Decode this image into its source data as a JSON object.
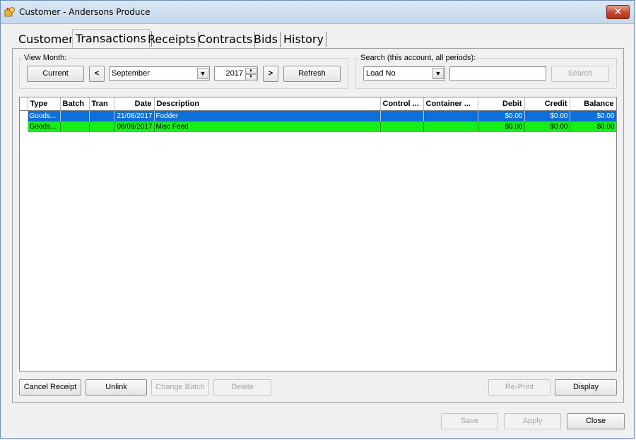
{
  "window": {
    "title": "Customer - Andersons Produce",
    "close_glyph": "✕"
  },
  "tabs": [
    {
      "label": "Customer"
    },
    {
      "label": "Transactions"
    },
    {
      "label": "Receipts"
    },
    {
      "label": "Contracts"
    },
    {
      "label": "Bids"
    },
    {
      "label": "History"
    }
  ],
  "active_tab": "Transactions",
  "view_month": {
    "label": "View Month:",
    "current_button": "Current",
    "prev_button": "<",
    "month": "September",
    "year": "2017",
    "next_button": ">",
    "refresh_button": "Refresh"
  },
  "search": {
    "label": "Search (this account, all periods):",
    "field": "Load No",
    "value": "",
    "search_button": "Search"
  },
  "grid": {
    "columns": [
      "",
      "Type",
      "Batch",
      "Tran",
      "Date",
      "Description",
      "Control ...",
      "Container ...",
      "Debit",
      "Credit",
      "Balance"
    ],
    "rows": [
      {
        "type": "Goods...",
        "batch": "",
        "tran": "",
        "date": "21/08/2017",
        "description": "Fodder",
        "control": "",
        "container": "",
        "debit": "$0.00",
        "credit": "$0.00",
        "balance": "$0.00",
        "state": "selected"
      },
      {
        "type": "Goods...",
        "batch": "",
        "tran": "",
        "date": "08/09/2017",
        "description": "Misc Feed",
        "control": "",
        "container": "",
        "debit": "$0.00",
        "credit": "$0.00",
        "balance": "$0.00",
        "state": "green"
      }
    ]
  },
  "actions": {
    "cancel_receipt": "Cancel Receipt",
    "unlink": "Unlink",
    "change_batch": "Change Batch",
    "delete": "Delete",
    "reprint": "Re-Print",
    "display": "Display"
  },
  "footer": {
    "save": "Save",
    "apply": "Apply",
    "close": "Close"
  },
  "colors": {
    "selected_row": "#0f6fd8",
    "green_row": "#17ee17",
    "title_gradient_top": "#dbe7f4",
    "close_button": "#c7462f"
  }
}
